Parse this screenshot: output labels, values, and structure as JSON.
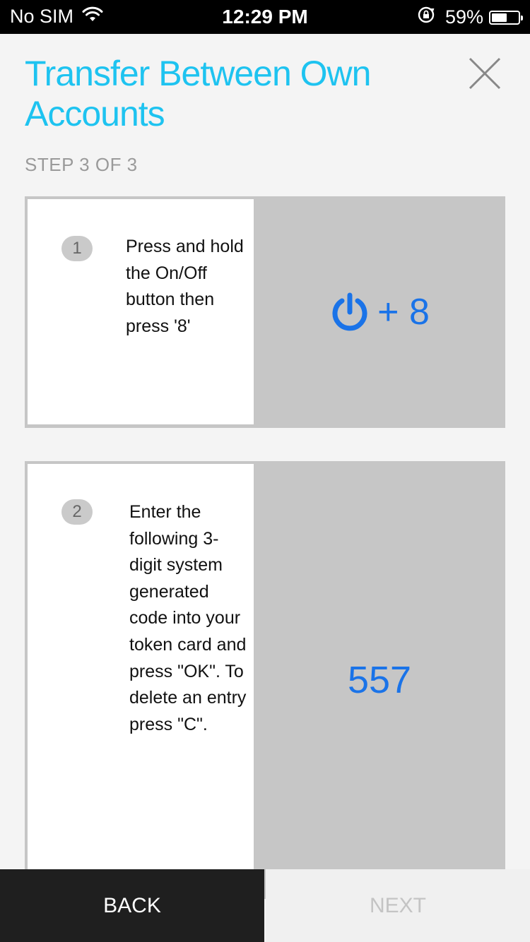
{
  "status_bar": {
    "carrier": "No SIM",
    "time": "12:29 PM",
    "battery_percent": "59%",
    "battery_level": 0.59,
    "icons": [
      "wifi-icon",
      "rotation-lock-icon",
      "battery-icon"
    ]
  },
  "header": {
    "title": "Transfer Between Own Accounts",
    "step": "STEP 3 OF 3",
    "close_icon": "close-icon"
  },
  "steps": [
    {
      "number": "1",
      "instruction": "Press and hold the On/Off button then press '8'",
      "display_icon": "power-icon",
      "display_text": "+ 8"
    },
    {
      "number": "2",
      "instruction": "Enter the following 3-digit system generated code into your token card and press \"OK\". To delete an entry press \"C\".",
      "display_text": "557"
    }
  ],
  "footer": {
    "back_label": "BACK",
    "next_label": "NEXT"
  },
  "colors": {
    "accent": "#1ec3f0",
    "display_blue": "#1a73e8",
    "back_bg": "#1f1f1f",
    "card_grey": "#c6c6c6"
  }
}
